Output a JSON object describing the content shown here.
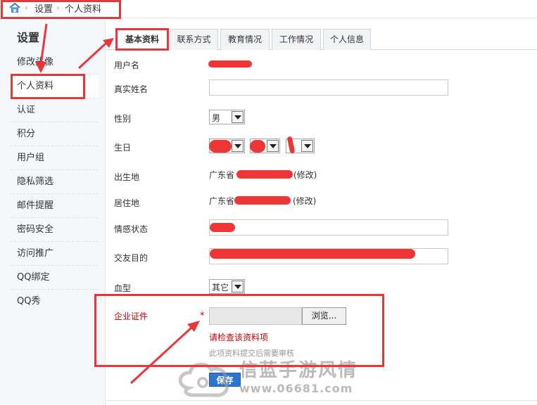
{
  "breadcrumb": {
    "items": [
      "设置",
      "个人资料"
    ]
  },
  "sidebar": {
    "title": "设置",
    "items": [
      {
        "label": "修改头像"
      },
      {
        "label": "个人资料",
        "active": true
      },
      {
        "label": "认证"
      },
      {
        "label": "积分"
      },
      {
        "label": "用户组"
      },
      {
        "label": "隐私筛选"
      },
      {
        "label": "邮件提醒"
      },
      {
        "label": "密码安全"
      },
      {
        "label": "访问推广"
      },
      {
        "label": "QQ绑定"
      },
      {
        "label": "QQ秀"
      }
    ]
  },
  "tabs": [
    {
      "label": "基本资料",
      "active": true
    },
    {
      "label": "联系方式"
    },
    {
      "label": "教育情况"
    },
    {
      "label": "工作情况"
    },
    {
      "label": "个人信息"
    }
  ],
  "form": {
    "username_label": "用户名",
    "realname_label": "真实姓名",
    "realname_value": "",
    "gender_label": "性别",
    "gender_value": "男",
    "birthday_label": "生日",
    "birthplace_label": "出生地",
    "birthplace_value": "广东省",
    "birthplace_edit": "(修改)",
    "residence_label": "居住地",
    "residence_value": "广东省",
    "residence_edit": "(修改)",
    "emotion_label": "情感状态",
    "purpose_label": "交友目的",
    "blood_label": "血型",
    "blood_value": "其它",
    "license_label": "企业证件",
    "required_mark": "*",
    "browse_label": "浏览...",
    "error_text": "请检查该资料项",
    "hint_text": "此项资料提交后需要审核",
    "save_label": "保存"
  },
  "watermark": {
    "text": "信蓝手游风情",
    "url": "www.06681.com"
  },
  "colors": {
    "annotation_red": "#e8373b",
    "save_blue": "#2f75cf",
    "error_red": "#cc0000"
  }
}
